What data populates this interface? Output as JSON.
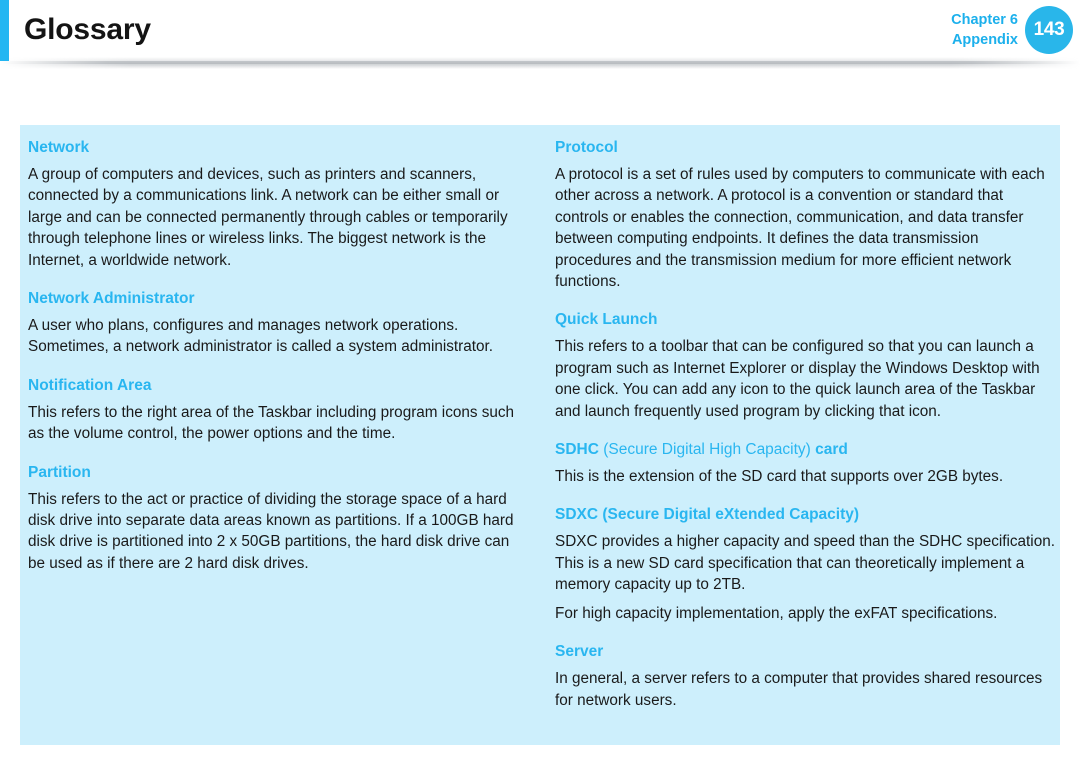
{
  "header": {
    "title": "Glossary",
    "chapter_line1": "Chapter 6",
    "chapter_line2": "Appendix",
    "page_number": "143",
    "accent_color": "#22b6f2",
    "badge_color": "#29b6ea",
    "chapter_text_color": "#1cb0ec"
  },
  "panel": {
    "background_color": "#cdeffc",
    "term_color": "#29b6f0",
    "body_color": "#1a1a1a"
  },
  "columns": {
    "left": [
      {
        "term": "Network",
        "paragraphs": [
          "A group of computers and devices, such as printers and scanners, connected by a communications link. A network can be either small or large and can be connected permanently through cables or temporarily through telephone lines or wireless links. The biggest network is the Internet, a worldwide network."
        ]
      },
      {
        "term": "Network Administrator",
        "paragraphs": [
          "A user who plans, configures and manages network operations. Sometimes, a network administrator is called a system administrator."
        ]
      },
      {
        "term": "Notification Area",
        "paragraphs": [
          "This refers to the right area of the Taskbar including program icons such as the volume control, the power options and the time."
        ]
      },
      {
        "term": "Partition",
        "paragraphs": [
          "This refers to the act or practice of dividing the storage space of a hard disk drive into separate data areas known as partitions. If a 100GB hard disk drive is partitioned into 2 x 50GB partitions, the hard disk drive can be used as if there are 2 hard disk drives."
        ]
      }
    ],
    "right": [
      {
        "term": "Protocol",
        "paragraphs": [
          "A protocol is a set of rules used by computers to communicate with each other across a network. A protocol is a convention or standard that controls or enables the connection, communication, and data transfer between computing endpoints. It defines the data transmission procedures and the transmission medium for more efficient network functions."
        ]
      },
      {
        "term": "Quick Launch",
        "paragraphs": [
          "This refers to a toolbar that can be configured so that you can launch a program such as Internet Explorer or display the Windows Desktop with one click. You can add any icon to the quick launch area of the Taskbar and launch frequently used program by clicking that icon."
        ]
      },
      {
        "term_bold_1": "SDHC",
        "term_normal": " (Secure Digital High Capacity) ",
        "term_bold_2": "card",
        "paragraphs": [
          "This is the extension of the SD card that supports over 2GB bytes."
        ]
      },
      {
        "term": "SDXC (Secure Digital eXtended Capacity)",
        "paragraphs": [
          "SDXC provides a higher capacity and speed than the SDHC specification. This is a new SD card specification that can theoretically implement a memory capacity up to 2TB.",
          "For high capacity implementation, apply the exFAT specifications."
        ]
      },
      {
        "term": "Server",
        "paragraphs": [
          "In general, a server refers to a computer that provides shared resources for network users."
        ]
      }
    ]
  }
}
